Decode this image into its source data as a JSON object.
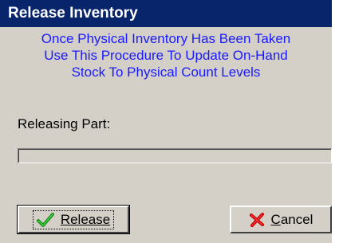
{
  "window": {
    "title": "Release Inventory"
  },
  "message": {
    "line1": "Once Physical Inventory Has Been Taken",
    "line2": "Use This Procedure To Update On-Hand",
    "line3": "Stock To Physical Count Levels"
  },
  "status": {
    "releasing_part_label": "Releasing Part:",
    "progress": 0
  },
  "buttons": {
    "release": {
      "label": "Release",
      "icon": "checkmark-icon"
    },
    "cancel": {
      "label": "Cancel",
      "icon": "red-x-icon"
    }
  },
  "colors": {
    "titlebar": "#08246b",
    "message_text": "#1a1aff",
    "dialog_bg": "#d4d0c8"
  }
}
